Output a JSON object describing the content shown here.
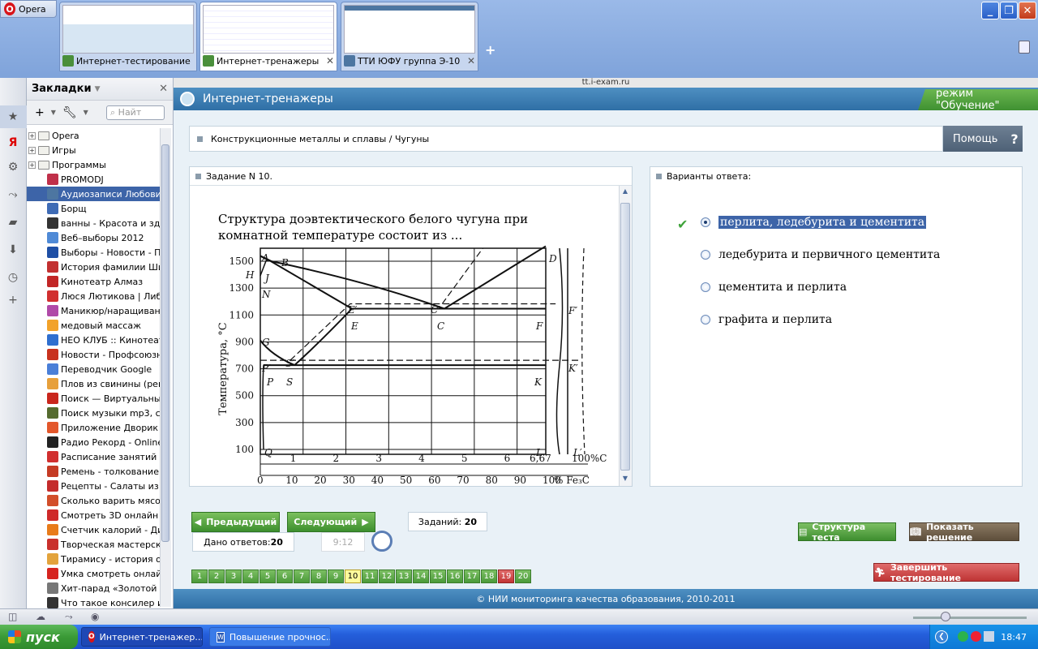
{
  "browser": {
    "menu_label": "Opera",
    "tabs": [
      {
        "title": "Интернет-тестирование",
        "active": false
      },
      {
        "title": "Интернет-тренажеры",
        "active": true
      },
      {
        "title": "ТТИ ЮФУ группа Э-10",
        "active": false
      }
    ],
    "address": "tt.i-exam.ru",
    "tab_close": "✕",
    "new_tab": "+"
  },
  "bookmarks": {
    "title": "Закладки",
    "search_placeholder": "Найт",
    "items": [
      {
        "label": "Opera",
        "type": "folder"
      },
      {
        "label": "Игры",
        "type": "folder"
      },
      {
        "label": "Программы",
        "type": "folder"
      },
      {
        "label": "PROMODJ",
        "type": "link",
        "color": "#c0304a"
      },
      {
        "label": "Аудиозаписи Любови ...",
        "type": "link",
        "color": "#4d76a1",
        "selected": true
      },
      {
        "label": "Борщ",
        "type": "link",
        "color": "#3e6bb5"
      },
      {
        "label": "ванны - Красота и здо...",
        "type": "link",
        "color": "#333333"
      },
      {
        "label": "Веб–выборы 2012",
        "type": "link",
        "color": "#4f8ad6"
      },
      {
        "label": "Выборы - Новости - Пе...",
        "type": "link",
        "color": "#1e4fa5"
      },
      {
        "label": "История фамилии Шил...",
        "type": "link",
        "color": "#c23030"
      },
      {
        "label": "Кинотеатр Алмаз",
        "type": "link",
        "color": "#c22626"
      },
      {
        "label": "Люся Лютикова | Либ...",
        "type": "link",
        "color": "#d12f2f"
      },
      {
        "label": "Маникюр/наращивани...",
        "type": "link",
        "color": "#b04aa8"
      },
      {
        "label": "медовый массаж",
        "type": "link",
        "color": "#f2a22a"
      },
      {
        "label": "НЕО КЛУБ :: Кинотеатр",
        "type": "link",
        "color": "#2f6fcf"
      },
      {
        "label": "Новости - Профсоюзн...",
        "type": "link",
        "color": "#c8321e"
      },
      {
        "label": "Переводчик Google",
        "type": "link",
        "color": "#4a7fd8"
      },
      {
        "label": "Плов из свинины (рец...",
        "type": "link",
        "color": "#e7a03b"
      },
      {
        "label": "Поиск — Виртуальный...",
        "type": "link",
        "color": "#c9261d"
      },
      {
        "label": "Поиск музыки mp3, ск...",
        "type": "link",
        "color": "#556b2f"
      },
      {
        "label": "Приложение Дворик п...",
        "type": "link",
        "color": "#e3572b"
      },
      {
        "label": "Радио Рекорд - Online ...",
        "type": "link",
        "color": "#222222"
      },
      {
        "label": "Расписание занятий",
        "type": "link",
        "color": "#d12f2f"
      },
      {
        "label": "Ремень - толкование с...",
        "type": "link",
        "color": "#c53b24"
      },
      {
        "label": "Рецепты - Салаты из ...",
        "type": "link",
        "color": "#c42c2c"
      },
      {
        "label": "Сколько варить мясо ...",
        "type": "link",
        "color": "#d24e2a"
      },
      {
        "label": "Смотреть 3D онлайн ф...",
        "type": "link",
        "color": "#cf2a2a"
      },
      {
        "label": "Счетчик калорий - Ди...",
        "type": "link",
        "color": "#e87b1a"
      },
      {
        "label": "Творческая мастерска...",
        "type": "link",
        "color": "#c9302c"
      },
      {
        "label": "Тирамису - история од...",
        "type": "link",
        "color": "#e3a33c"
      },
      {
        "label": "Умка смотреть онлайн...",
        "type": "link",
        "color": "#d6241f"
      },
      {
        "label": "Хит-парад «Золотой Г...",
        "type": "link",
        "color": "#777777"
      },
      {
        "label": "Что такое консилер и ...",
        "type": "link",
        "color": "#333333"
      }
    ]
  },
  "app": {
    "title": "Интернет-тренажеры",
    "mode": "режим \"Обучение\"",
    "breadcrumb": "Конструкционные металлы и сплавы / Чугуны",
    "help": "Помощь",
    "help_icon": "?",
    "task_header": "Задание N 10.",
    "answers_header": "Варианты ответа:",
    "question_line1": "Структура доэвтектического белого чугуна при",
    "question_line2": "комнатной температуре состоит из ...",
    "options": [
      {
        "text": "перлита, ледебурита и цементита",
        "selected": true,
        "correct": true
      },
      {
        "text": "ледебурита и первичного цементита",
        "selected": false
      },
      {
        "text": "цементита и перлита",
        "selected": false
      },
      {
        "text": "графита и перлита",
        "selected": false
      }
    ],
    "prev": "Предыдущий",
    "next": "Следующий",
    "tasks_label": "Заданий:",
    "tasks_count": "20",
    "given_label": "Дано ответов:",
    "given_count": "20",
    "timer": "9:12",
    "question_numbers": [
      "1",
      "2",
      "3",
      "4",
      "5",
      "6",
      "7",
      "8",
      "9",
      "10",
      "11",
      "12",
      "13",
      "14",
      "15",
      "16",
      "17",
      "18",
      "19",
      "20"
    ],
    "current_question": "10",
    "flagged_question": "19",
    "structure_btn": "Структура теста",
    "solution_btn": "Показать решение",
    "finish_btn": "Завершить тестирование",
    "footer": "© НИИ мониторинга качества образования, 2010-2011"
  },
  "diagram": {
    "y_axis_label": "Температура, °С",
    "y_ticks": [
      "1500",
      "1300",
      "1100",
      "900",
      "700",
      "500",
      "300",
      "100"
    ],
    "c_ticks": [
      "1",
      "2",
      "3",
      "4",
      "5",
      "6",
      "6,67",
      "100%С"
    ],
    "fe3c_ticks": [
      "0",
      "10",
      "20",
      "30",
      "40",
      "50",
      "60",
      "70",
      "80",
      "90",
      "100",
      "% Fe₃C"
    ],
    "points": [
      "A",
      "B",
      "H",
      "J",
      "N",
      "E′",
      "C′",
      "D",
      "E",
      "C",
      "F′",
      "F",
      "G",
      "S′",
      "P′",
      "K′",
      "P",
      "S",
      "K",
      "Q",
      "L",
      "L′"
    ]
  },
  "taskbar": {
    "start": "пуск",
    "items": [
      "Интернет-тренажер...",
      "Повышение прочнос..."
    ],
    "time": "18:47"
  }
}
